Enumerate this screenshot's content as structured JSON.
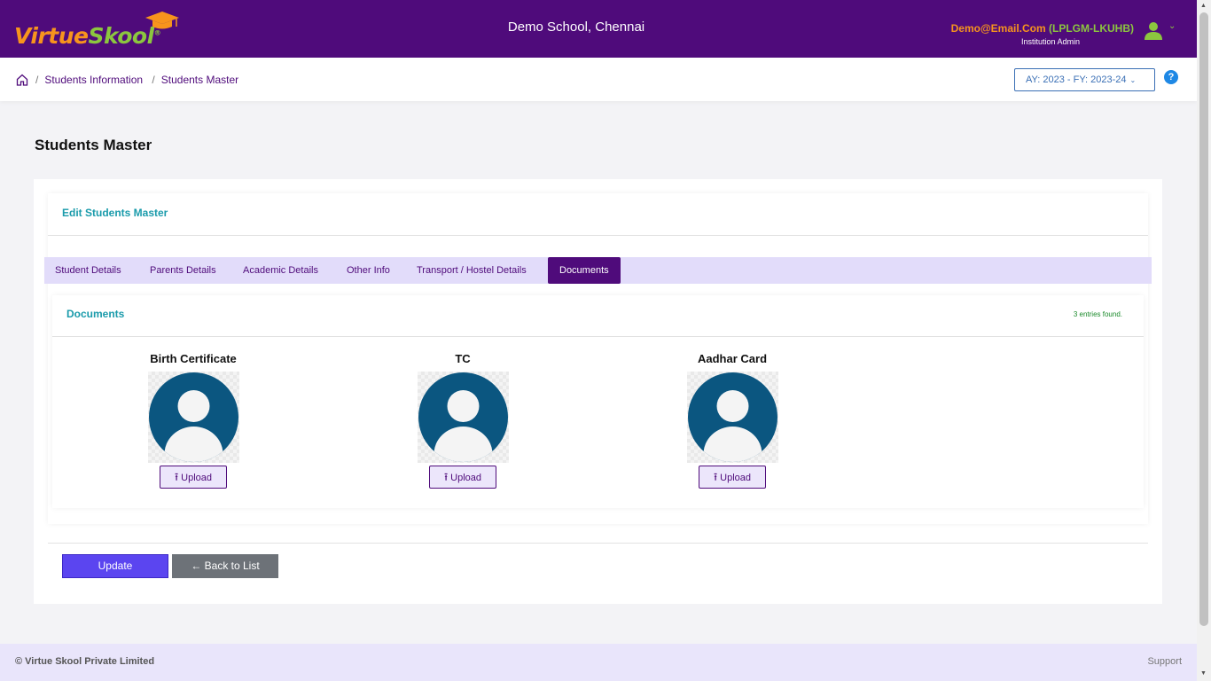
{
  "brand": {
    "logo_part1": "Virtue",
    "logo_part2": "Skool",
    "logo_reg": "®",
    "colors": {
      "orange": "#f7941d",
      "green": "#8cc63f",
      "purple": "#4f0b7b"
    }
  },
  "header": {
    "school": "Demo School, Chennai",
    "user_email": "Demo@Email.Com",
    "user_code": "(LPLGM-LKUHB)",
    "user_role": "Institution Admin",
    "user_icon": "user-icon",
    "menu_icon": "chevron-down-icon"
  },
  "breadcrumb": {
    "items": [
      "Students Information",
      "Students Master"
    ],
    "separator": "/"
  },
  "year_select": {
    "value": "AY: 2023 - FY: 2023-24"
  },
  "help": {
    "label": "?"
  },
  "page": {
    "title": "Students Master"
  },
  "form": {
    "title": "Edit Students Master"
  },
  "tabs": [
    {
      "label": "Student Details"
    },
    {
      "label": "Parents Details"
    },
    {
      "label": "Academic Details"
    },
    {
      "label": "Other Info"
    },
    {
      "label": "Transport / Hostel Details"
    },
    {
      "label": "Documents",
      "active": true
    }
  ],
  "documents": {
    "title": "Documents",
    "count_text": "3 entries found.",
    "items": [
      {
        "name": "Birth Certificate",
        "button": "Upload"
      },
      {
        "name": "TC",
        "button": "Upload"
      },
      {
        "name": "Aadhar Card",
        "button": "Upload"
      }
    ]
  },
  "actions": {
    "update": "Update",
    "back": "Back to List"
  },
  "footer": {
    "copyright": "© Virtue Skool Private Limited",
    "support": "Support"
  }
}
